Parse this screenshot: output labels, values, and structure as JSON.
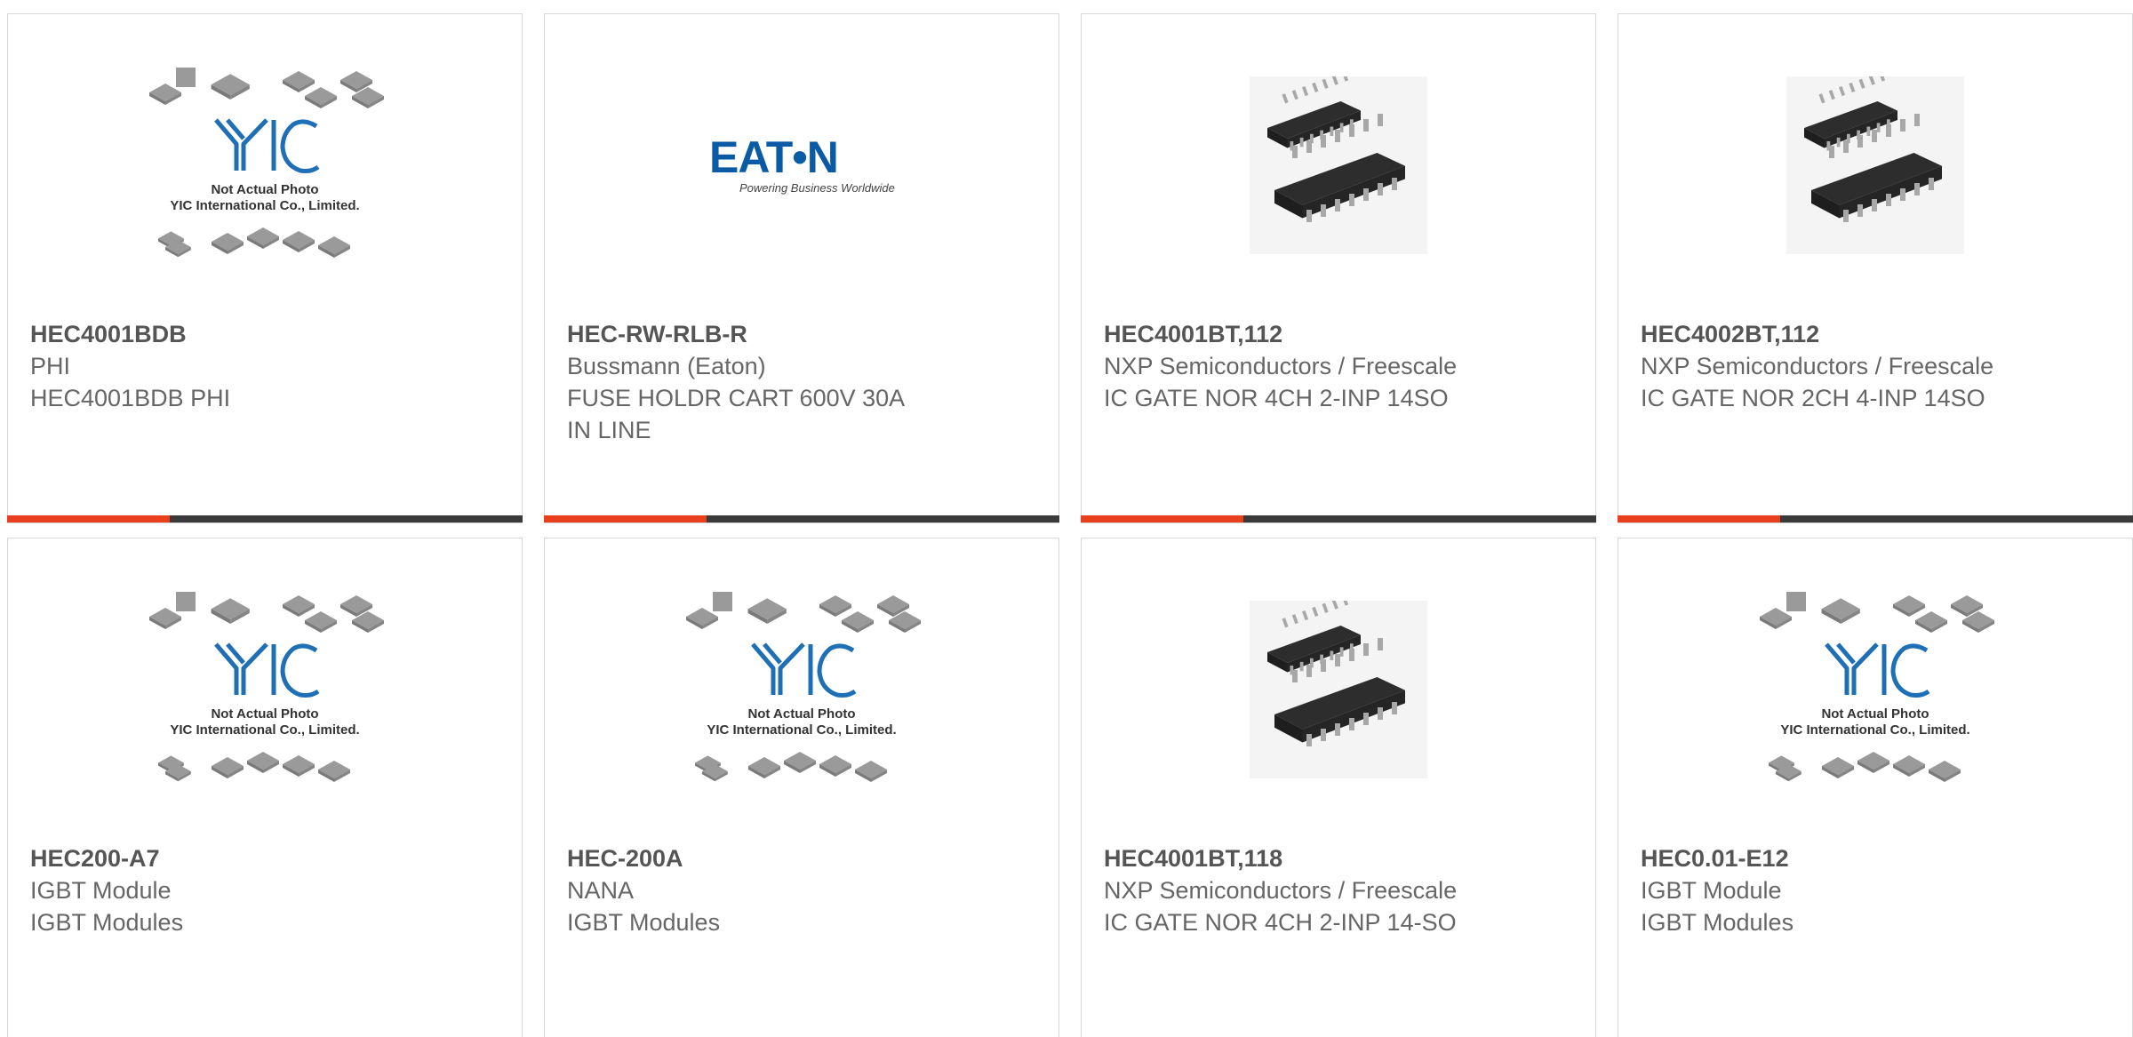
{
  "brand_colors": {
    "accent": "#e8401c",
    "bar": "#3a3a3a",
    "text": "#666666"
  },
  "placeholder": {
    "logo": "YIC",
    "line1": "Not Actual Photo",
    "line2": "YIC International Co., Limited."
  },
  "eaton": {
    "logo": "EAT•N",
    "tagline": "Powering Business Worldwide"
  },
  "products": [
    {
      "part_number": "HEC4001BDB",
      "manufacturer": "PHI",
      "description": "HEC4001BDB PHI",
      "image": "placeholder"
    },
    {
      "part_number": "HEC-RW-RLB-R",
      "manufacturer": "Bussmann (Eaton)",
      "description": "FUSE HOLDR CART 600V 30A",
      "description2": "IN LINE",
      "image": "eaton-logo"
    },
    {
      "part_number": "HEC4001BT,112",
      "manufacturer": "NXP Semiconductors / Freescale",
      "description": "IC GATE NOR 4CH 2-INP 14SO",
      "image": "soic-chip"
    },
    {
      "part_number": "HEC4002BT,112",
      "manufacturer": "NXP Semiconductors / Freescale",
      "description": "IC GATE NOR 2CH 4-INP 14SO",
      "image": "soic-chip"
    },
    {
      "part_number": "HEC200-A7",
      "manufacturer": "IGBT Module",
      "description": "IGBT Modules",
      "image": "placeholder"
    },
    {
      "part_number": "HEC-200A",
      "manufacturer": "NANA",
      "description": "IGBT Modules",
      "image": "placeholder"
    },
    {
      "part_number": "HEC4001BT,118",
      "manufacturer": "NXP Semiconductors / Freescale",
      "description": "IC GATE NOR 4CH 2-INP 14-SO",
      "image": "soic-chip"
    },
    {
      "part_number": "HEC0.01-E12",
      "manufacturer": "IGBT Module",
      "description": "IGBT Modules",
      "image": "placeholder"
    }
  ]
}
